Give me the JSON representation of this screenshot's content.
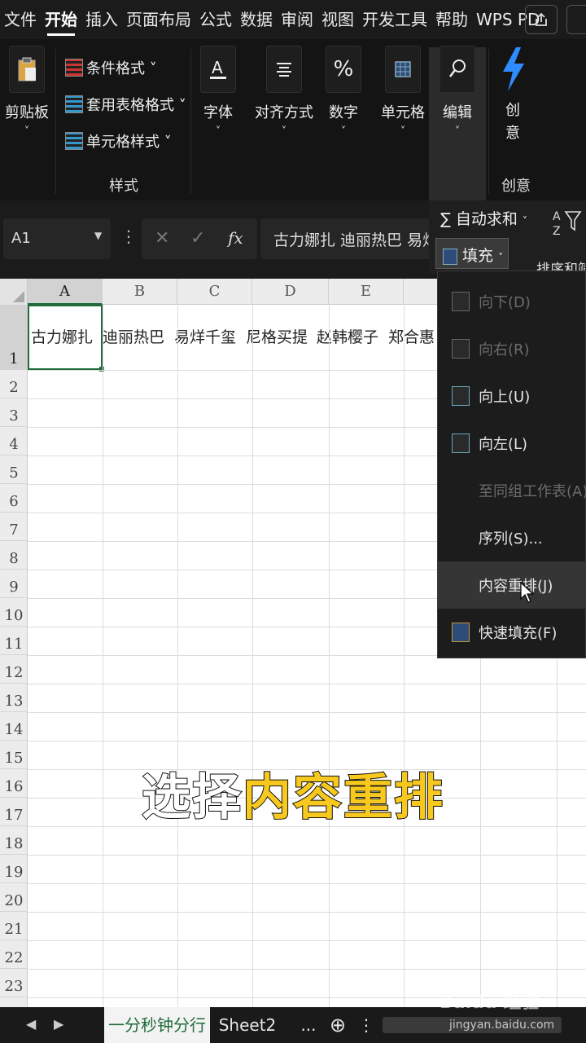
{
  "menubar": {
    "tabs": [
      "文件",
      "开始",
      "插入",
      "页面布局",
      "公式",
      "数据",
      "审阅",
      "视图",
      "开发工具",
      "帮助",
      "WPS PD"
    ],
    "active_tab": "开始"
  },
  "ribbon": {
    "clipboard_label": "剪贴板",
    "styles": {
      "conditional_format": "条件格式 ˅",
      "table_format": "套用表格格式 ˅",
      "cell_style": "单元格样式 ˅",
      "caption": "样式"
    },
    "font_label": "字体",
    "align_label": "对齐方式",
    "number_label": "数字",
    "cells_label": "单元格",
    "edit_label": "编辑",
    "create_label_1": "创",
    "create_label_2": "意",
    "create_caption": "创意",
    "autosum_label": "自动求和",
    "fill_label": "填充",
    "sort_label": "排序和筛"
  },
  "formula_bar": {
    "name_box": "A1",
    "cancel_glyph": "✕",
    "confirm_glyph": "✓",
    "fx_glyph": "fx",
    "content": "古力娜扎 迪丽热巴 易烊"
  },
  "sheet": {
    "columns": [
      "A",
      "B",
      "C",
      "D",
      "E"
    ],
    "rows": [
      "1",
      "2",
      "3",
      "4",
      "5",
      "6",
      "7",
      "8",
      "9",
      "10",
      "11",
      "12",
      "13",
      "14",
      "15",
      "16",
      "17",
      "18",
      "19",
      "20",
      "21",
      "22",
      "23"
    ],
    "row1_cells": [
      "古力娜扎",
      "迪丽热巴",
      "易烊千玺",
      "尼格买提",
      "赵韩樱子",
      "郑合惠"
    ]
  },
  "fill_menu": {
    "items": [
      {
        "label": "向下(D)",
        "enabled": false
      },
      {
        "label": "向右(R)",
        "enabled": false
      },
      {
        "label": "向上(U)",
        "enabled": true
      },
      {
        "label": "向左(L)",
        "enabled": true
      },
      {
        "label": "至同组工作表(A)...",
        "enabled": false
      },
      {
        "label": "序列(S)...",
        "enabled": true
      },
      {
        "label": "内容重排(J)",
        "enabled": true,
        "hovered": true
      },
      {
        "label": "快速填充(F)",
        "enabled": true
      }
    ]
  },
  "caption": {
    "part1": "选择",
    "part2": "内容重排"
  },
  "tabs": {
    "sheet1": "一分秒钟分行",
    "sheet2": "Sheet2",
    "more": "...",
    "add": "⊕",
    "options": "⋮"
  },
  "watermark": {
    "brand": "Baidu 经验",
    "url": "jingyan.baidu.com"
  },
  "colors": {
    "excel_green": "#1f6b3a",
    "caption_yellow": "#f7c81e",
    "dark_bg": "#141414"
  }
}
